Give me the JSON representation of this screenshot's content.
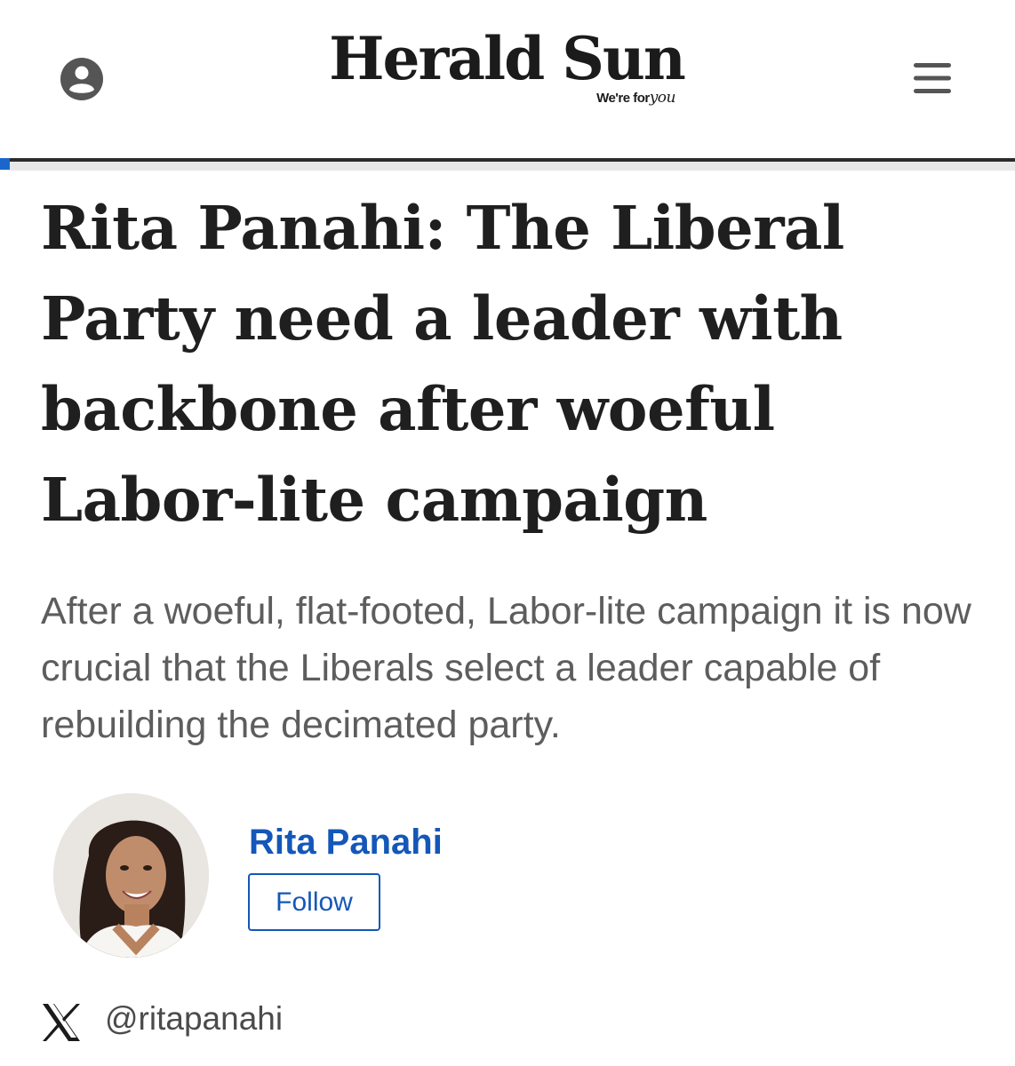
{
  "header": {
    "masthead_title": "Herald Sun",
    "masthead_tagline_prefix": "We're for",
    "masthead_tagline_em": "you",
    "account_icon": "user-account-icon",
    "menu_icon": "hamburger-menu-icon"
  },
  "article": {
    "headline": "Rita Panahi: The Liberal Party need a leader with backbone after woeful Labor-lite campaign",
    "standfirst": "After a woeful, flat-footed, Labor-lite campaign it is now crucial that the Liberals select a leader capable of rebuilding the decimated party.",
    "reading_progress": 0.01
  },
  "byline": {
    "author_name": "Rita Panahi",
    "follow_label": "Follow",
    "social_icon": "x-logo-icon",
    "social_handle": "@ritapanahi"
  },
  "colors": {
    "link_blue": "#1457b8",
    "progress_blue": "#1a66cc",
    "headline": "#1f1f1f",
    "standfirst": "#5d5d5d",
    "icon_gray": "#555555"
  }
}
